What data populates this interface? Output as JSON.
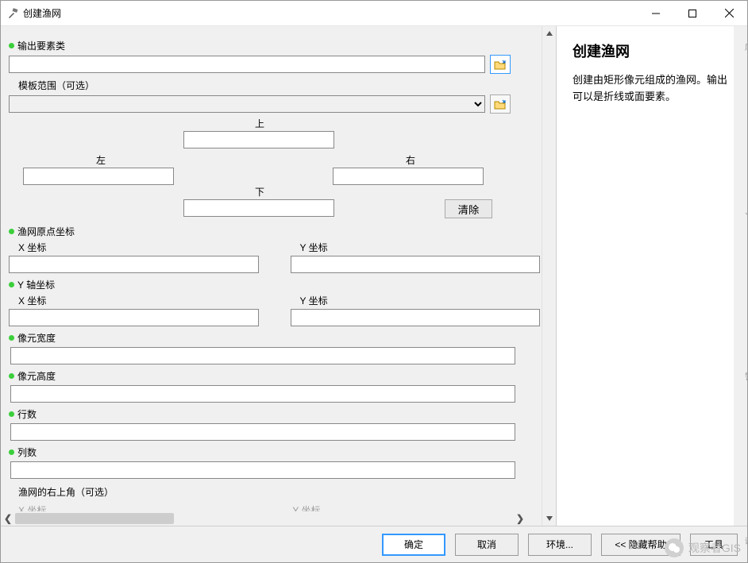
{
  "window": {
    "title": "创建渔网"
  },
  "help": {
    "title": "创建渔网",
    "text": "创建由矩形像元组成的渔网。输出可以是折线或面要素。"
  },
  "labels": {
    "output_fc": "输出要素类",
    "template_extent": "模板范围（可选）",
    "top": "上",
    "left": "左",
    "right": "右",
    "bottom": "下",
    "clear": "清除",
    "origin": "渔网原点坐标",
    "xcoord": "X 坐标",
    "ycoord": "Y 坐标",
    "yaxis": "Y 轴坐标",
    "cell_width": "像元宽度",
    "cell_height": "像元高度",
    "rows": "行数",
    "cols": "列数",
    "opp_corner": "渔网的右上角（可选）",
    "cut_x": "X 坐标",
    "cut_y": "Y 坐标"
  },
  "values": {
    "output_fc": "",
    "template_extent": "",
    "top": "",
    "left": "",
    "right": "",
    "bottom": "",
    "origin_x": "",
    "origin_y": "",
    "yaxis_x": "",
    "yaxis_y": "",
    "cell_width": "",
    "cell_height": "",
    "rows": "",
    "cols": ""
  },
  "buttons": {
    "ok": "确定",
    "cancel": "取消",
    "env": "环境...",
    "hide_help": "<<  隐藏帮助",
    "tool": "工具"
  },
  "watermark": "观察者GIS"
}
